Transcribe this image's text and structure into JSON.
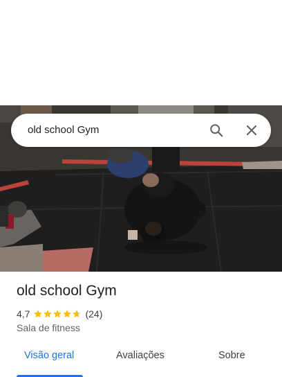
{
  "search": {
    "query": "old school Gym"
  },
  "place": {
    "name": "old school Gym",
    "rating": "4,7",
    "rating_value": 4.7,
    "review_count": "(24)",
    "category": "Sala de fitness"
  },
  "tabs": [
    {
      "label": "Visão geral",
      "active": true
    },
    {
      "label": "Avaliações",
      "active": false
    },
    {
      "label": "Sobre",
      "active": false
    }
  ],
  "colors": {
    "accent": "#1a73e8",
    "star": "#fbbc04"
  }
}
